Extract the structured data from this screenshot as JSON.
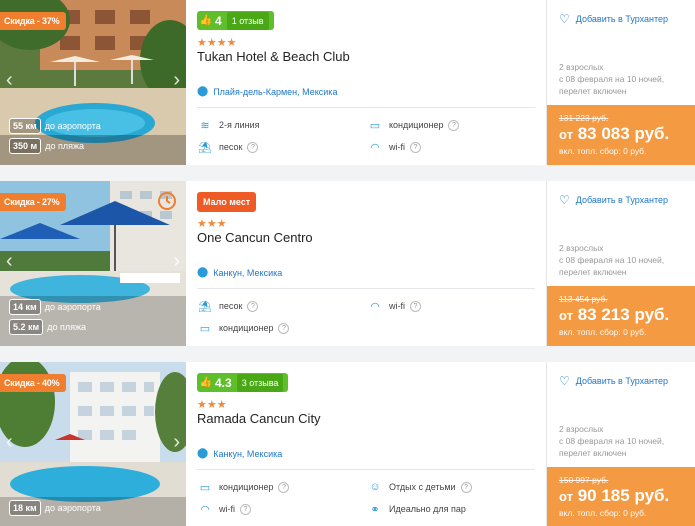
{
  "colors": {
    "accent_orange": "#ef7e2f",
    "price_orange": "#f39a43",
    "rating_green": "#5fbf2a",
    "link_blue": "#1f77c9",
    "few_red": "#ee5b25"
  },
  "hotels": [
    {
      "discount": "Скидка - 37%",
      "badge_type": "rating",
      "rating_score": "4",
      "rating_reviews": "1 отзыв",
      "stars": "★★★★",
      "name": "Tukan Hotel & Beach Club",
      "location": "Плайя-дель-Кармен, Мексика",
      "distances": [
        {
          "km": "55 км",
          "label": "до аэропорта"
        },
        {
          "km": "350 м",
          "label": "до пляжа"
        }
      ],
      "amenities": [
        {
          "icon": "beach-line-icon",
          "label": "2-я линия",
          "help": false
        },
        {
          "icon": "air-conditioner-icon",
          "label": "кондиционер",
          "help": true
        },
        {
          "icon": "sand-icon",
          "label": "песок",
          "help": true
        },
        {
          "icon": "wifi-icon",
          "label": "wi-fi",
          "help": true
        }
      ],
      "favorite": "Добавить в Турхантер",
      "pax": [
        "2 взрослых",
        "с 08 февраля на 10 ночей,",
        "перелет включен"
      ],
      "old_price": "131 223 руб.",
      "price_prefix": "от",
      "price": "83 083 руб.",
      "fee": "вкл. топл. сбор: 0 руб."
    },
    {
      "discount": "Скидка - 27%",
      "badge_type": "few",
      "few_label": "Мало мест",
      "stars": "★★★",
      "name": "One Cancun Centro",
      "location": "Канкун, Мексика",
      "distances": [
        {
          "km": "14 км",
          "label": "до аэропорта"
        },
        {
          "km": "5.2 км",
          "label": "до пляжа"
        }
      ],
      "amenities": [
        {
          "icon": "sand-icon",
          "label": "песок",
          "help": true
        },
        {
          "icon": "wifi-icon",
          "label": "wi-fi",
          "help": true
        },
        {
          "icon": "air-conditioner-icon",
          "label": "кондиционер",
          "help": true
        }
      ],
      "favorite": "Добавить в Турхантер",
      "pax": [
        "2 взрослых",
        "с 08 февраля на 10 ночей,",
        "перелет включен"
      ],
      "old_price": "113 454 руб.",
      "price_prefix": "от",
      "price": "83 213 руб.",
      "fee": "вкл. топл. сбор: 0 руб."
    },
    {
      "discount": "Скидка - 40%",
      "badge_type": "rating",
      "rating_score": "4.3",
      "rating_reviews": "3 отзыва",
      "stars": "★★★",
      "name": "Ramada Cancun City",
      "location": "Канкун, Мексика",
      "distances": [
        {
          "km": "18 км",
          "label": "до аэропорта"
        }
      ],
      "amenities": [
        {
          "icon": "air-conditioner-icon",
          "label": "кондиционер",
          "help": true
        },
        {
          "icon": "kids-icon",
          "label": "Отдых с детьми",
          "help": true
        },
        {
          "icon": "wifi-icon",
          "label": "wi-fi",
          "help": true
        },
        {
          "icon": "couple-icon",
          "label": "Идеально для пар",
          "help": false
        }
      ],
      "favorite": "Добавить в Турхантер",
      "pax": [
        "2 взрослых",
        "с 08 февраля на 10 ночей,",
        "перелет включен"
      ],
      "old_price": "150 997 руб.",
      "price_prefix": "от",
      "price": "90 185 руб.",
      "fee": "вкл. топл. сбор: 0 руб."
    }
  ]
}
